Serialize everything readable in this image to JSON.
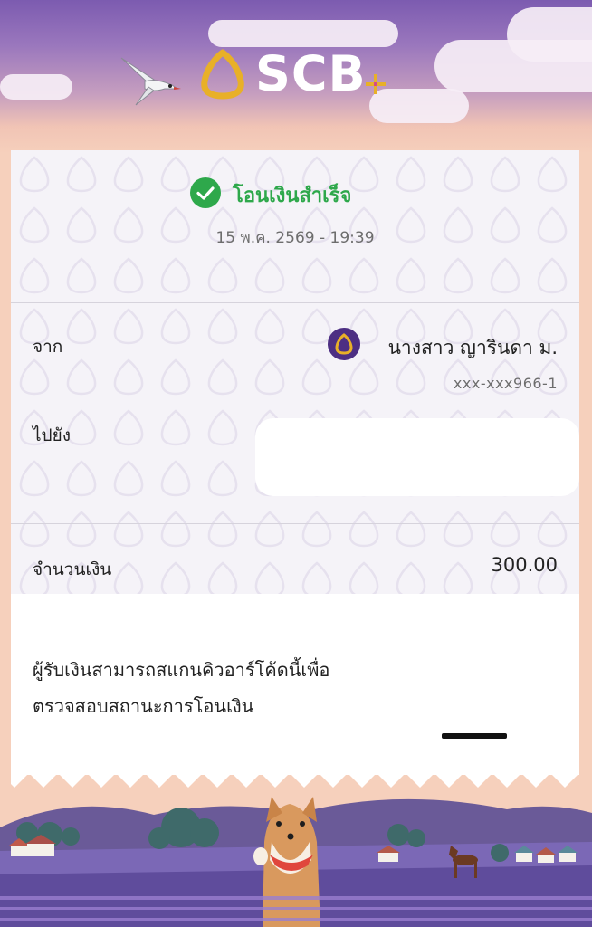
{
  "brand": {
    "name": "SCB",
    "accent_color": "#e8b028",
    "sky_color": "#7c5bb0",
    "icons": [
      "scb-logo-icon",
      "plus-sparkle-icon",
      "bird-icon"
    ]
  },
  "status": {
    "label": "โอนเงินสำเร็จ",
    "icon": "check-circle-icon",
    "color": "#2ea84b"
  },
  "datetime": "15 พ.ค. 2569 - 19:39",
  "from": {
    "label": "จาก",
    "name": "นางสาว ญารินดา ม.",
    "account": "xxx-xxx966-1"
  },
  "to": {
    "label": "ไปยัง"
  },
  "amount": {
    "label": "จำนวนเงิน",
    "value": "300.00"
  },
  "qr_note": {
    "line1": "ผู้รับเงินสามารถสแกนคิวอาร์โค้ดนี้เพื่อ",
    "line2": "ตรวจสอบสถานะการโอนเงิน"
  },
  "footer_illustration": [
    "shiba-dog",
    "lavender-field",
    "horse",
    "houses"
  ]
}
